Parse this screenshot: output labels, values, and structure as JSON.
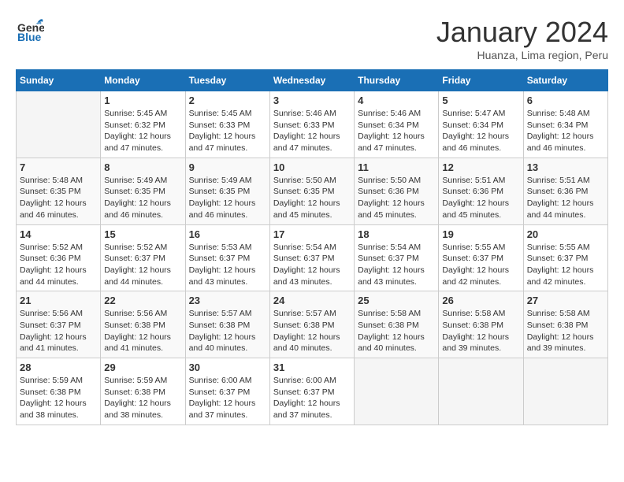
{
  "header": {
    "logo_line1": "General",
    "logo_line2": "Blue",
    "month_title": "January 2024",
    "subtitle": "Huanza, Lima region, Peru"
  },
  "weekdays": [
    "Sunday",
    "Monday",
    "Tuesday",
    "Wednesday",
    "Thursday",
    "Friday",
    "Saturday"
  ],
  "weeks": [
    [
      {
        "day": "",
        "info": ""
      },
      {
        "day": "1",
        "info": "Sunrise: 5:45 AM\nSunset: 6:32 PM\nDaylight: 12 hours\nand 47 minutes."
      },
      {
        "day": "2",
        "info": "Sunrise: 5:45 AM\nSunset: 6:33 PM\nDaylight: 12 hours\nand 47 minutes."
      },
      {
        "day": "3",
        "info": "Sunrise: 5:46 AM\nSunset: 6:33 PM\nDaylight: 12 hours\nand 47 minutes."
      },
      {
        "day": "4",
        "info": "Sunrise: 5:46 AM\nSunset: 6:34 PM\nDaylight: 12 hours\nand 47 minutes."
      },
      {
        "day": "5",
        "info": "Sunrise: 5:47 AM\nSunset: 6:34 PM\nDaylight: 12 hours\nand 46 minutes."
      },
      {
        "day": "6",
        "info": "Sunrise: 5:48 AM\nSunset: 6:34 PM\nDaylight: 12 hours\nand 46 minutes."
      }
    ],
    [
      {
        "day": "7",
        "info": "Sunrise: 5:48 AM\nSunset: 6:35 PM\nDaylight: 12 hours\nand 46 minutes."
      },
      {
        "day": "8",
        "info": "Sunrise: 5:49 AM\nSunset: 6:35 PM\nDaylight: 12 hours\nand 46 minutes."
      },
      {
        "day": "9",
        "info": "Sunrise: 5:49 AM\nSunset: 6:35 PM\nDaylight: 12 hours\nand 46 minutes."
      },
      {
        "day": "10",
        "info": "Sunrise: 5:50 AM\nSunset: 6:35 PM\nDaylight: 12 hours\nand 45 minutes."
      },
      {
        "day": "11",
        "info": "Sunrise: 5:50 AM\nSunset: 6:36 PM\nDaylight: 12 hours\nand 45 minutes."
      },
      {
        "day": "12",
        "info": "Sunrise: 5:51 AM\nSunset: 6:36 PM\nDaylight: 12 hours\nand 45 minutes."
      },
      {
        "day": "13",
        "info": "Sunrise: 5:51 AM\nSunset: 6:36 PM\nDaylight: 12 hours\nand 44 minutes."
      }
    ],
    [
      {
        "day": "14",
        "info": "Sunrise: 5:52 AM\nSunset: 6:36 PM\nDaylight: 12 hours\nand 44 minutes."
      },
      {
        "day": "15",
        "info": "Sunrise: 5:52 AM\nSunset: 6:37 PM\nDaylight: 12 hours\nand 44 minutes."
      },
      {
        "day": "16",
        "info": "Sunrise: 5:53 AM\nSunset: 6:37 PM\nDaylight: 12 hours\nand 43 minutes."
      },
      {
        "day": "17",
        "info": "Sunrise: 5:54 AM\nSunset: 6:37 PM\nDaylight: 12 hours\nand 43 minutes."
      },
      {
        "day": "18",
        "info": "Sunrise: 5:54 AM\nSunset: 6:37 PM\nDaylight: 12 hours\nand 43 minutes."
      },
      {
        "day": "19",
        "info": "Sunrise: 5:55 AM\nSunset: 6:37 PM\nDaylight: 12 hours\nand 42 minutes."
      },
      {
        "day": "20",
        "info": "Sunrise: 5:55 AM\nSunset: 6:37 PM\nDaylight: 12 hours\nand 42 minutes."
      }
    ],
    [
      {
        "day": "21",
        "info": "Sunrise: 5:56 AM\nSunset: 6:37 PM\nDaylight: 12 hours\nand 41 minutes."
      },
      {
        "day": "22",
        "info": "Sunrise: 5:56 AM\nSunset: 6:38 PM\nDaylight: 12 hours\nand 41 minutes."
      },
      {
        "day": "23",
        "info": "Sunrise: 5:57 AM\nSunset: 6:38 PM\nDaylight: 12 hours\nand 40 minutes."
      },
      {
        "day": "24",
        "info": "Sunrise: 5:57 AM\nSunset: 6:38 PM\nDaylight: 12 hours\nand 40 minutes."
      },
      {
        "day": "25",
        "info": "Sunrise: 5:58 AM\nSunset: 6:38 PM\nDaylight: 12 hours\nand 40 minutes."
      },
      {
        "day": "26",
        "info": "Sunrise: 5:58 AM\nSunset: 6:38 PM\nDaylight: 12 hours\nand 39 minutes."
      },
      {
        "day": "27",
        "info": "Sunrise: 5:58 AM\nSunset: 6:38 PM\nDaylight: 12 hours\nand 39 minutes."
      }
    ],
    [
      {
        "day": "28",
        "info": "Sunrise: 5:59 AM\nSunset: 6:38 PM\nDaylight: 12 hours\nand 38 minutes."
      },
      {
        "day": "29",
        "info": "Sunrise: 5:59 AM\nSunset: 6:38 PM\nDaylight: 12 hours\nand 38 minutes."
      },
      {
        "day": "30",
        "info": "Sunrise: 6:00 AM\nSunset: 6:37 PM\nDaylight: 12 hours\nand 37 minutes."
      },
      {
        "day": "31",
        "info": "Sunrise: 6:00 AM\nSunset: 6:37 PM\nDaylight: 12 hours\nand 37 minutes."
      },
      {
        "day": "",
        "info": ""
      },
      {
        "day": "",
        "info": ""
      },
      {
        "day": "",
        "info": ""
      }
    ]
  ]
}
